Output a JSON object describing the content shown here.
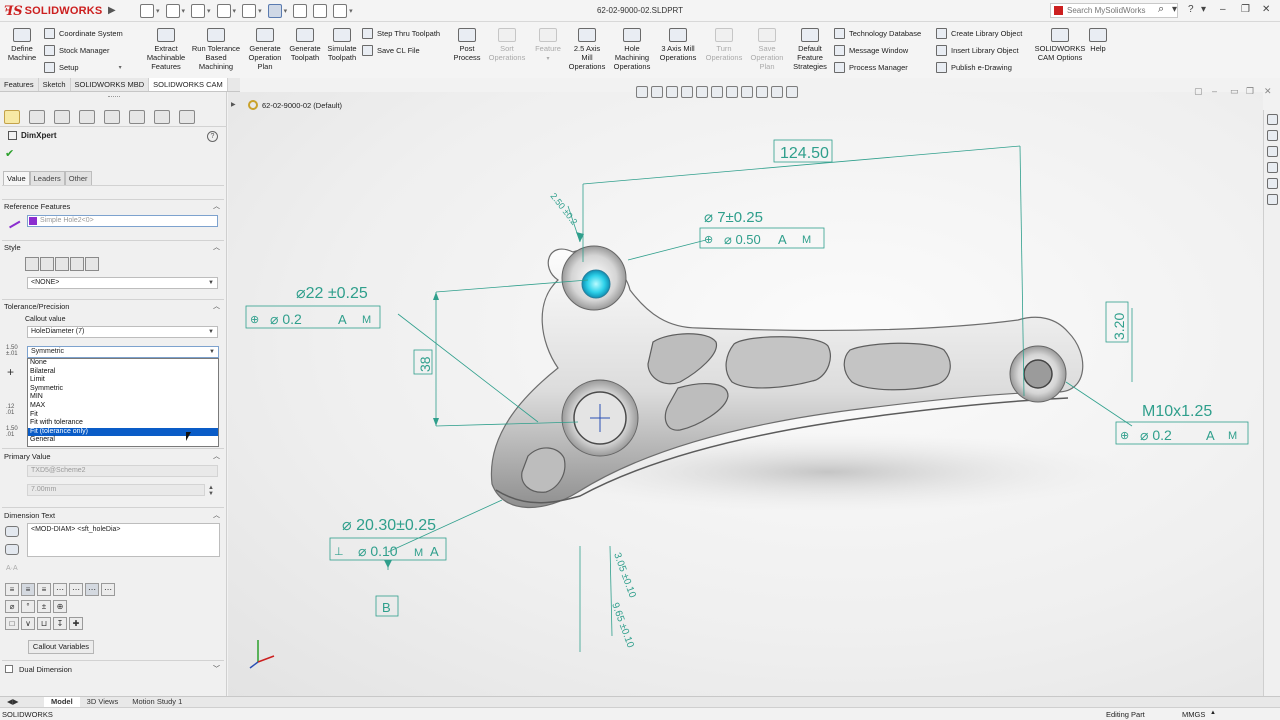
{
  "titlebar": {
    "app_name": "SOLIDWORKS",
    "document_title": "62-02-9000-02.SLDPRT",
    "search_placeholder": "Search MySolidWorks"
  },
  "ribbon": {
    "buttons": [
      {
        "l1": "Define",
        "l2": "Machine",
        "l3": ""
      },
      {
        "l1": "Extract",
        "l2": "Machinable",
        "l3": "Features"
      },
      {
        "l1": "Run Tolerance",
        "l2": "Based",
        "l3": "Machining"
      },
      {
        "l1": "Generate",
        "l2": "Operation",
        "l3": "Plan"
      },
      {
        "l1": "Generate",
        "l2": "Toolpath",
        "l3": ""
      },
      {
        "l1": "Simulate",
        "l2": "Toolpath",
        "l3": ""
      },
      {
        "l1": "Post",
        "l2": "Process",
        "l3": ""
      },
      {
        "l1": "Sort",
        "l2": "Operations",
        "l3": ""
      },
      {
        "l1": "Feature",
        "l2": "",
        "l3": ""
      },
      {
        "l1": "2.5 Axis",
        "l2": "Mill",
        "l3": "Operations"
      },
      {
        "l1": "Hole",
        "l2": "Machining",
        "l3": "Operations"
      },
      {
        "l1": "3 Axis Mill",
        "l2": "Operations",
        "l3": ""
      },
      {
        "l1": "Turn",
        "l2": "Operations",
        "l3": ""
      },
      {
        "l1": "Save",
        "l2": "Operation",
        "l3": "Plan"
      },
      {
        "l1": "Default",
        "l2": "Feature",
        "l3": "Strategies"
      },
      {
        "l1": "SOLIDWORKS",
        "l2": "CAM Options",
        "l3": ""
      },
      {
        "l1": "Help",
        "l2": "",
        "l3": ""
      }
    ],
    "small": {
      "coordinate_system": "Coordinate System",
      "stock_manager": "Stock Manager",
      "setup": "Setup",
      "step_thru_toolpath": "Step Thru Toolpath",
      "save_cl_file": "Save CL File",
      "technology_database": "Technology Database",
      "message_window": "Message Window",
      "process_manager": "Process Manager",
      "create_library_object": "Create Library Object",
      "insert_library_object": "Insert Library Object",
      "publish_edrawing": "Publish e-Drawing"
    }
  },
  "command_tabs": [
    "Features",
    "Sketch",
    "SOLIDWORKS MBD",
    "SOLIDWORKS CAM"
  ],
  "tree": {
    "part_name": "62-02-9000-02 (Default)"
  },
  "propertymanager": {
    "title": "DimXpert",
    "subtabs": [
      "Value",
      "Leaders",
      "Other"
    ],
    "reference_features": {
      "header": "Reference Features",
      "value": "Simple Hole2<0>"
    },
    "style": {
      "header": "Style",
      "value": "<NONE>"
    },
    "tolerance": {
      "header": "Tolerance/Precision",
      "callout_label": "Callout value",
      "callout_value": "HoleDiameter (7)",
      "type_value": "Symmetric",
      "options": [
        "None",
        "Bilateral",
        "Limit",
        "Symmetric",
        "MIN",
        "MAX",
        "Fit",
        "Fit with tolerance",
        "Fit (tolerance only)",
        "General"
      ],
      "selected_option": "Fit (tolerance only)"
    },
    "primary_value": {
      "header": "Primary Value",
      "field1": "TXD5@Scheme2",
      "field2": "7.00mm"
    },
    "dimension_text": {
      "header": "Dimension Text",
      "value": "<MOD-DIAM> <sft_holeDia>"
    },
    "callout_variables_button": "Callout Variables",
    "dual_dimension": "Dual Dimension"
  },
  "annotations": {
    "a124": "124.50",
    "a250": "2.50 ±0.2",
    "a7": "⌀ 7±0.25",
    "a7_fcf_tol": "⌀ 0.50",
    "a7_fcf_m": "M",
    "a22": "⌀22 ±0.25",
    "a22_fcf_tol": "⌀ 0.2",
    "a22_fcf_m": "M",
    "a38": "38",
    "a320": "3.20",
    "m10": "M10x1.25",
    "m10_fcf_tol": "⌀ 0.2",
    "m10_fcf_m": "M",
    "a2030": "⌀ 20.30±0.25",
    "a2030_fcf_tol": "⌀ 0.10",
    "a2030_fcf_m": "M",
    "datum_a": "A",
    "datum_b": "B",
    "a305": "3.05 ±0.10",
    "a965": "9.65 ±0.10"
  },
  "bottom_tabs": [
    "Model",
    "3D Views",
    "Motion Study 1"
  ],
  "status": {
    "left": "SOLIDWORKS",
    "mode": "Editing Part",
    "units": "MMGS"
  },
  "colors": {
    "annotation": "#2f9f8c",
    "brand": "#cc1f1f",
    "selection": "#0a5cc7"
  }
}
